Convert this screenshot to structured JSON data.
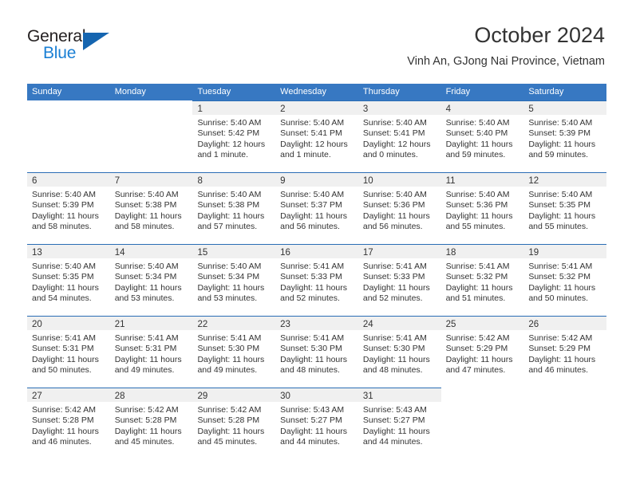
{
  "brand": {
    "word1": "General",
    "word2": "Blue",
    "triangle_color": "#1565b0"
  },
  "header": {
    "title": "October 2024",
    "location": "Vinh An, GJong Nai Province, Vietnam"
  },
  "theme": {
    "header_blue": "#3778c2",
    "row_rule_blue": "#2a6db5",
    "daynum_band": "#f0f0f0"
  },
  "calendar": {
    "weekdays": [
      "Sunday",
      "Monday",
      "Tuesday",
      "Wednesday",
      "Thursday",
      "Friday",
      "Saturday"
    ],
    "weeks": [
      [
        {
          "empty": true
        },
        {
          "empty": true
        },
        {
          "day": "1",
          "sunrise": "Sunrise: 5:40 AM",
          "sunset": "Sunset: 5:42 PM",
          "daylight1": "Daylight: 12 hours",
          "daylight2": "and 1 minute."
        },
        {
          "day": "2",
          "sunrise": "Sunrise: 5:40 AM",
          "sunset": "Sunset: 5:41 PM",
          "daylight1": "Daylight: 12 hours",
          "daylight2": "and 1 minute."
        },
        {
          "day": "3",
          "sunrise": "Sunrise: 5:40 AM",
          "sunset": "Sunset: 5:41 PM",
          "daylight1": "Daylight: 12 hours",
          "daylight2": "and 0 minutes."
        },
        {
          "day": "4",
          "sunrise": "Sunrise: 5:40 AM",
          "sunset": "Sunset: 5:40 PM",
          "daylight1": "Daylight: 11 hours",
          "daylight2": "and 59 minutes."
        },
        {
          "day": "5",
          "sunrise": "Sunrise: 5:40 AM",
          "sunset": "Sunset: 5:39 PM",
          "daylight1": "Daylight: 11 hours",
          "daylight2": "and 59 minutes."
        }
      ],
      [
        {
          "day": "6",
          "sunrise": "Sunrise: 5:40 AM",
          "sunset": "Sunset: 5:39 PM",
          "daylight1": "Daylight: 11 hours",
          "daylight2": "and 58 minutes."
        },
        {
          "day": "7",
          "sunrise": "Sunrise: 5:40 AM",
          "sunset": "Sunset: 5:38 PM",
          "daylight1": "Daylight: 11 hours",
          "daylight2": "and 58 minutes."
        },
        {
          "day": "8",
          "sunrise": "Sunrise: 5:40 AM",
          "sunset": "Sunset: 5:38 PM",
          "daylight1": "Daylight: 11 hours",
          "daylight2": "and 57 minutes."
        },
        {
          "day": "9",
          "sunrise": "Sunrise: 5:40 AM",
          "sunset": "Sunset: 5:37 PM",
          "daylight1": "Daylight: 11 hours",
          "daylight2": "and 56 minutes."
        },
        {
          "day": "10",
          "sunrise": "Sunrise: 5:40 AM",
          "sunset": "Sunset: 5:36 PM",
          "daylight1": "Daylight: 11 hours",
          "daylight2": "and 56 minutes."
        },
        {
          "day": "11",
          "sunrise": "Sunrise: 5:40 AM",
          "sunset": "Sunset: 5:36 PM",
          "daylight1": "Daylight: 11 hours",
          "daylight2": "and 55 minutes."
        },
        {
          "day": "12",
          "sunrise": "Sunrise: 5:40 AM",
          "sunset": "Sunset: 5:35 PM",
          "daylight1": "Daylight: 11 hours",
          "daylight2": "and 55 minutes."
        }
      ],
      [
        {
          "day": "13",
          "sunrise": "Sunrise: 5:40 AM",
          "sunset": "Sunset: 5:35 PM",
          "daylight1": "Daylight: 11 hours",
          "daylight2": "and 54 minutes."
        },
        {
          "day": "14",
          "sunrise": "Sunrise: 5:40 AM",
          "sunset": "Sunset: 5:34 PM",
          "daylight1": "Daylight: 11 hours",
          "daylight2": "and 53 minutes."
        },
        {
          "day": "15",
          "sunrise": "Sunrise: 5:40 AM",
          "sunset": "Sunset: 5:34 PM",
          "daylight1": "Daylight: 11 hours",
          "daylight2": "and 53 minutes."
        },
        {
          "day": "16",
          "sunrise": "Sunrise: 5:41 AM",
          "sunset": "Sunset: 5:33 PM",
          "daylight1": "Daylight: 11 hours",
          "daylight2": "and 52 minutes."
        },
        {
          "day": "17",
          "sunrise": "Sunrise: 5:41 AM",
          "sunset": "Sunset: 5:33 PM",
          "daylight1": "Daylight: 11 hours",
          "daylight2": "and 52 minutes."
        },
        {
          "day": "18",
          "sunrise": "Sunrise: 5:41 AM",
          "sunset": "Sunset: 5:32 PM",
          "daylight1": "Daylight: 11 hours",
          "daylight2": "and 51 minutes."
        },
        {
          "day": "19",
          "sunrise": "Sunrise: 5:41 AM",
          "sunset": "Sunset: 5:32 PM",
          "daylight1": "Daylight: 11 hours",
          "daylight2": "and 50 minutes."
        }
      ],
      [
        {
          "day": "20",
          "sunrise": "Sunrise: 5:41 AM",
          "sunset": "Sunset: 5:31 PM",
          "daylight1": "Daylight: 11 hours",
          "daylight2": "and 50 minutes."
        },
        {
          "day": "21",
          "sunrise": "Sunrise: 5:41 AM",
          "sunset": "Sunset: 5:31 PM",
          "daylight1": "Daylight: 11 hours",
          "daylight2": "and 49 minutes."
        },
        {
          "day": "22",
          "sunrise": "Sunrise: 5:41 AM",
          "sunset": "Sunset: 5:30 PM",
          "daylight1": "Daylight: 11 hours",
          "daylight2": "and 49 minutes."
        },
        {
          "day": "23",
          "sunrise": "Sunrise: 5:41 AM",
          "sunset": "Sunset: 5:30 PM",
          "daylight1": "Daylight: 11 hours",
          "daylight2": "and 48 minutes."
        },
        {
          "day": "24",
          "sunrise": "Sunrise: 5:41 AM",
          "sunset": "Sunset: 5:30 PM",
          "daylight1": "Daylight: 11 hours",
          "daylight2": "and 48 minutes."
        },
        {
          "day": "25",
          "sunrise": "Sunrise: 5:42 AM",
          "sunset": "Sunset: 5:29 PM",
          "daylight1": "Daylight: 11 hours",
          "daylight2": "and 47 minutes."
        },
        {
          "day": "26",
          "sunrise": "Sunrise: 5:42 AM",
          "sunset": "Sunset: 5:29 PM",
          "daylight1": "Daylight: 11 hours",
          "daylight2": "and 46 minutes."
        }
      ],
      [
        {
          "day": "27",
          "sunrise": "Sunrise: 5:42 AM",
          "sunset": "Sunset: 5:28 PM",
          "daylight1": "Daylight: 11 hours",
          "daylight2": "and 46 minutes."
        },
        {
          "day": "28",
          "sunrise": "Sunrise: 5:42 AM",
          "sunset": "Sunset: 5:28 PM",
          "daylight1": "Daylight: 11 hours",
          "daylight2": "and 45 minutes."
        },
        {
          "day": "29",
          "sunrise": "Sunrise: 5:42 AM",
          "sunset": "Sunset: 5:28 PM",
          "daylight1": "Daylight: 11 hours",
          "daylight2": "and 45 minutes."
        },
        {
          "day": "30",
          "sunrise": "Sunrise: 5:43 AM",
          "sunset": "Sunset: 5:27 PM",
          "daylight1": "Daylight: 11 hours",
          "daylight2": "and 44 minutes."
        },
        {
          "day": "31",
          "sunrise": "Sunrise: 5:43 AM",
          "sunset": "Sunset: 5:27 PM",
          "daylight1": "Daylight: 11 hours",
          "daylight2": "and 44 minutes."
        },
        {
          "empty": true
        },
        {
          "empty": true
        }
      ]
    ]
  }
}
